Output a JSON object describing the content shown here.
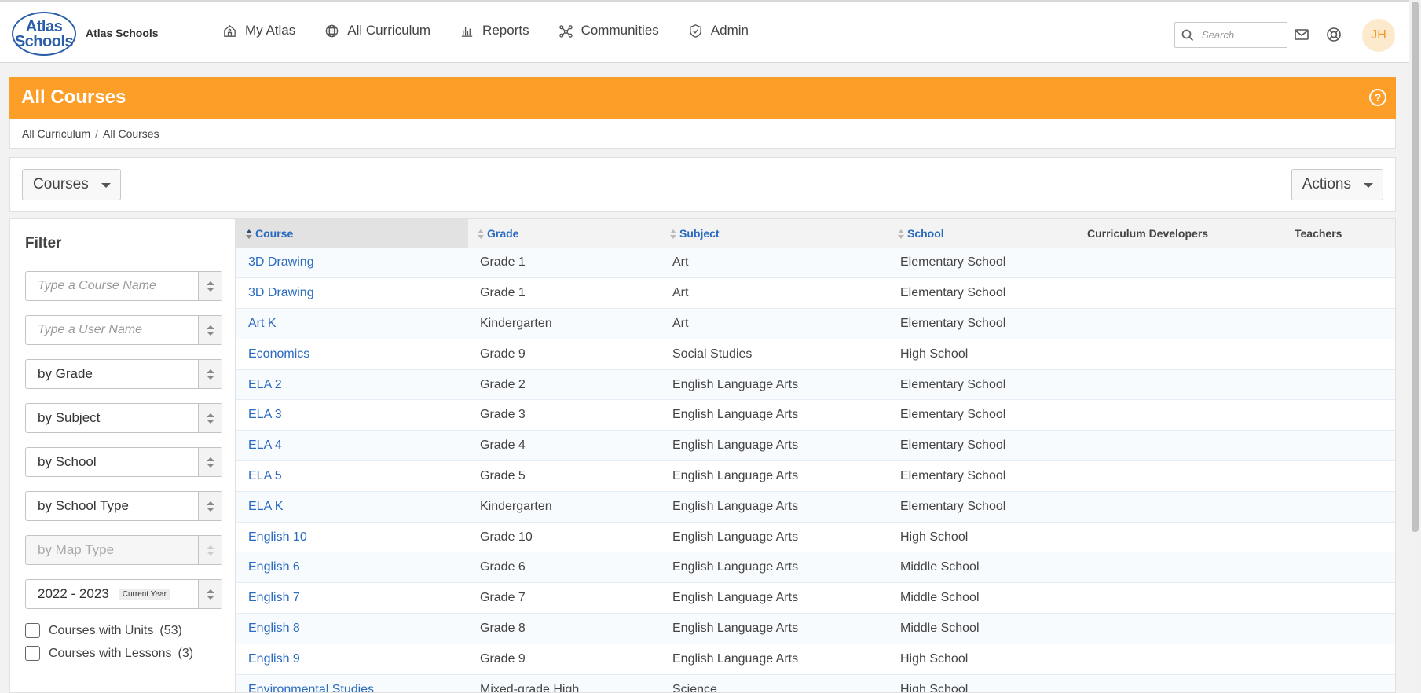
{
  "brand": {
    "logo_line1": "Atlas",
    "logo_line2": "Schools",
    "name": "Atlas Schools"
  },
  "nav": [
    {
      "label": "My Atlas",
      "icon": "home-icon"
    },
    {
      "label": "All Curriculum",
      "icon": "globe-icon"
    },
    {
      "label": "Reports",
      "icon": "bar-chart-icon"
    },
    {
      "label": "Communities",
      "icon": "network-icon"
    },
    {
      "label": "Admin",
      "icon": "shield-icon"
    }
  ],
  "search": {
    "placeholder": "Search",
    "value": ""
  },
  "user": {
    "initials": "JH"
  },
  "page": {
    "title": "All Courses",
    "help": "?"
  },
  "breadcrumb": {
    "parent": "All Curriculum",
    "separator": "/",
    "current": "All Courses"
  },
  "toolbar": {
    "view_label": "Courses",
    "actions_label": "Actions"
  },
  "filter": {
    "title": "Filter",
    "course_name_placeholder": "Type a Course Name",
    "user_name_placeholder": "Type a User Name",
    "grade": "by Grade",
    "subject": "by Subject",
    "school": "by School",
    "school_type": "by School Type",
    "map_type": "by Map Type",
    "year": "2022 - 2023",
    "year_badge": "Current Year",
    "units_label": "Courses with Units",
    "units_count": "(53)",
    "lessons_label": "Courses with Lessons",
    "lessons_count": "(3)"
  },
  "table": {
    "headers": [
      "Course",
      "Grade",
      "Subject",
      "School",
      "Curriculum Developers",
      "Teachers"
    ],
    "rows": [
      [
        "3D Drawing",
        "Grade 1",
        "Art",
        "Elementary School"
      ],
      [
        "3D Drawing",
        "Grade 1",
        "Art",
        "Elementary School"
      ],
      [
        "Art K",
        "Kindergarten",
        "Art",
        "Elementary School"
      ],
      [
        "Economics",
        "Grade 9",
        "Social Studies",
        "High School"
      ],
      [
        "ELA 2",
        "Grade 2",
        "English Language Arts",
        "Elementary School"
      ],
      [
        "ELA 3",
        "Grade 3",
        "English Language Arts",
        "Elementary School"
      ],
      [
        "ELA 4",
        "Grade 4",
        "English Language Arts",
        "Elementary School"
      ],
      [
        "ELA 5",
        "Grade 5",
        "English Language Arts",
        "Elementary School"
      ],
      [
        "ELA K",
        "Kindergarten",
        "English Language Arts",
        "Elementary School"
      ],
      [
        "English 10",
        "Grade 10",
        "English Language Arts",
        "High School"
      ],
      [
        "English 6",
        "Grade 6",
        "English Language Arts",
        "Middle School"
      ],
      [
        "English 7",
        "Grade 7",
        "English Language Arts",
        "Middle School"
      ],
      [
        "English 8",
        "Grade 8",
        "English Language Arts",
        "Middle School"
      ],
      [
        "English 9",
        "Grade 9",
        "English Language Arts",
        "High School"
      ],
      [
        "Environmental Studies",
        "Mixed-grade High",
        "Science",
        "High School"
      ]
    ]
  }
}
